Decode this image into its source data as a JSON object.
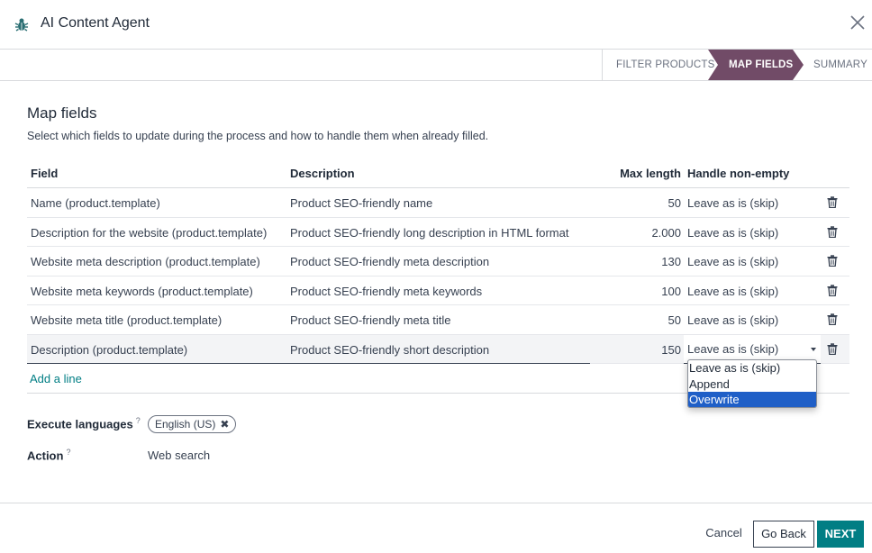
{
  "header": {
    "title": "AI Content Agent"
  },
  "steps": [
    {
      "label": "FILTER PRODUCTS",
      "active": false
    },
    {
      "label": "MAP FIELDS",
      "active": true
    },
    {
      "label": "SUMMARY",
      "active": false
    }
  ],
  "main": {
    "title": "Map fields",
    "subtitle": "Select which fields to update during the process and how to handle them when already filled.",
    "columns": {
      "field": "Field",
      "description": "Description",
      "max_length": "Max length",
      "handle": "Handle non-empty"
    },
    "rows": [
      {
        "field": "Name (product.template)",
        "description": "Product SEO-friendly name",
        "max_length": "50",
        "handle": "Leave as is (skip)"
      },
      {
        "field": "Description for the website (product.template)",
        "description": "Product SEO-friendly long description in HTML format",
        "max_length": "2.000",
        "handle": "Leave as is (skip)"
      },
      {
        "field": "Website meta description (product.template)",
        "description": "Product SEO-friendly meta description",
        "max_length": "130",
        "handle": "Leave as is (skip)"
      },
      {
        "field": "Website meta keywords (product.template)",
        "description": "Product SEO-friendly meta keywords",
        "max_length": "100",
        "handle": "Leave as is (skip)"
      },
      {
        "field": "Website meta title (product.template)",
        "description": "Product SEO-friendly meta title",
        "max_length": "50",
        "handle": "Leave as is (skip)"
      },
      {
        "field": "Description (product.template)",
        "description": "Product SEO-friendly short description",
        "max_length": "150",
        "handle": "Leave as is (skip)"
      }
    ],
    "add_line": "Add a line",
    "dropdown": {
      "options": [
        "Leave as is (skip)",
        "Append",
        "Overwrite"
      ],
      "highlighted": "Overwrite"
    },
    "languages_label": "Execute languages",
    "languages_help": "?",
    "language_tag": "English (US)",
    "action_label": "Action",
    "action_help": "?",
    "action_value": "Web search"
  },
  "footer": {
    "cancel": "Cancel",
    "back": "Go Back",
    "next": "NEXT"
  },
  "colors": {
    "accent": "#017e84",
    "active_step": "#714b67",
    "selection": "#1f5fc7"
  }
}
